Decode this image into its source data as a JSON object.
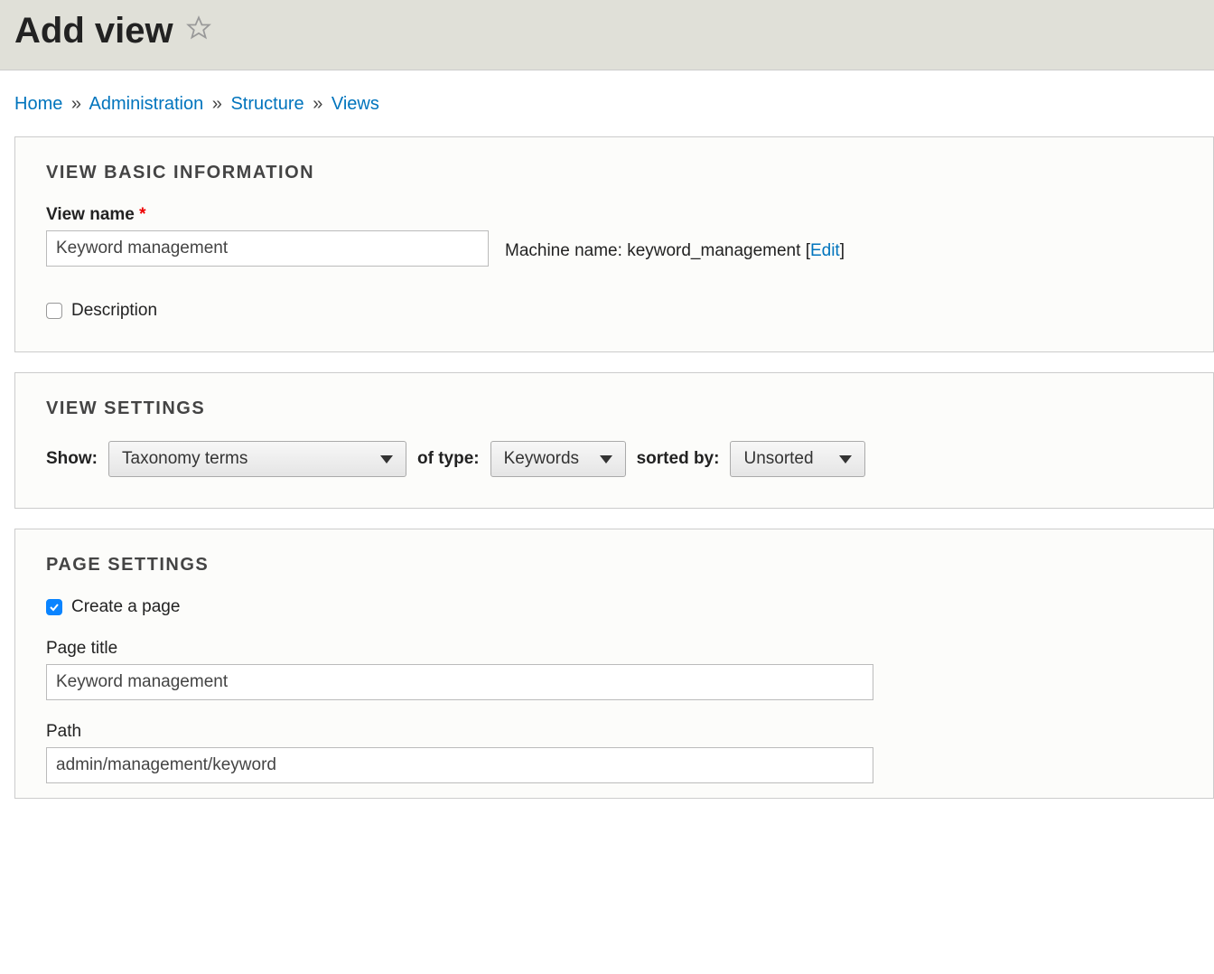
{
  "page": {
    "title": "Add view"
  },
  "breadcrumb": {
    "home": "Home",
    "administration": "Administration",
    "structure": "Structure",
    "views": "Views",
    "sep": "»"
  },
  "basic_info": {
    "panel_title": "VIEW BASIC INFORMATION",
    "view_name_label": "View name",
    "view_name_value": "Keyword management",
    "machine_name_label": "Machine name:",
    "machine_name_value": "keyword_management",
    "edit_link": "Edit",
    "description_label": "Description",
    "description_checked": false
  },
  "view_settings": {
    "panel_title": "VIEW SETTINGS",
    "show_label": "Show:",
    "show_value": "Taxonomy terms",
    "of_type_label": "of type:",
    "of_type_value": "Keywords",
    "sorted_by_label": "sorted by:",
    "sorted_by_value": "Unsorted"
  },
  "page_settings": {
    "panel_title": "PAGE SETTINGS",
    "create_page_label": "Create a page",
    "create_page_checked": true,
    "page_title_label": "Page title",
    "page_title_value": "Keyword management",
    "path_label": "Path",
    "path_value": "admin/management/keyword"
  }
}
